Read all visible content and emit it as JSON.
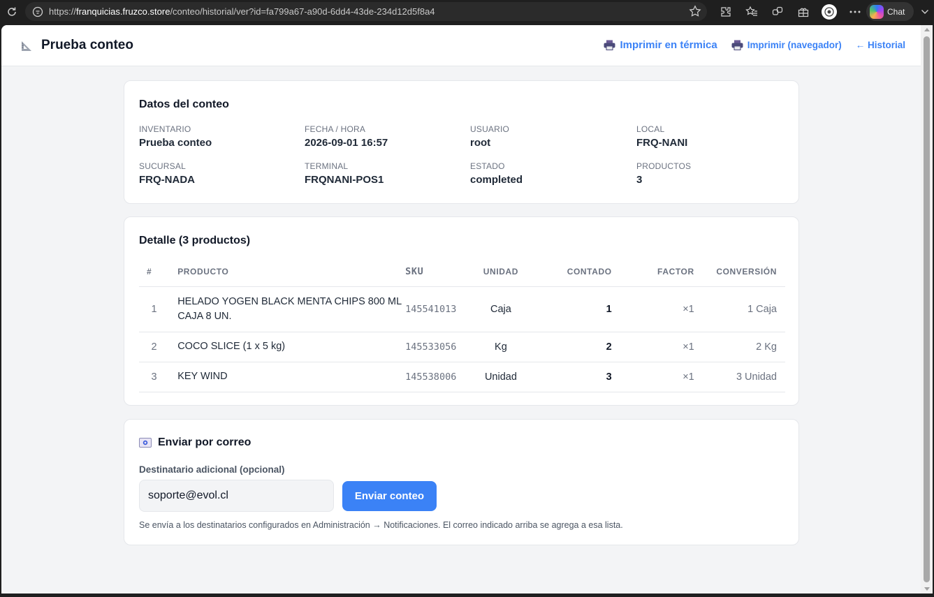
{
  "browser": {
    "url_scheme": "https://",
    "url_host": "franquicias.fruzco.store",
    "url_path": "/conteo/historial/ver?id=fa799a67-a90d-6dd4-43de-234d12d5f8a4",
    "chat_label": "Chat",
    "icons": [
      "reload-icon",
      "site-info-icon",
      "favorite-star-icon",
      "extensions-icon",
      "favorites-icon",
      "collections-icon",
      "browser-essentials-icon",
      "profile-icon",
      "more-icon",
      "copilot-icon",
      "chevron-icon"
    ]
  },
  "header": {
    "title": "Prueba conteo",
    "title_icon": "ruler-icon",
    "actions": {
      "print_thermal": "Imprimir en térmica",
      "print_browser": "Imprimir (navegador)",
      "history": "← Historial"
    }
  },
  "datos": {
    "title": "Datos del conteo",
    "fields": [
      {
        "label": "INVENTARIO",
        "value": "Prueba conteo"
      },
      {
        "label": "FECHA / HORA",
        "value": "2026-09-01 16:57"
      },
      {
        "label": "USUARIO",
        "value": "root"
      },
      {
        "label": "LOCAL",
        "value": "FRQ-NANI"
      },
      {
        "label": "SUCURSAL",
        "value": "FRQ-NADA"
      },
      {
        "label": "TERMINAL",
        "value": "FRQNANI-POS1"
      },
      {
        "label": "ESTADO",
        "value": "completed"
      },
      {
        "label": "PRODUCTOS",
        "value": "3"
      }
    ]
  },
  "detalle": {
    "title": "Detalle (3 productos)",
    "columns": {
      "num": "#",
      "producto": "PRODUCTO",
      "sku": "SKU",
      "unidad": "UNIDAD",
      "contado": "CONTADO",
      "factor": "FACTOR",
      "conversion": "CONVERSIÓN"
    },
    "rows": [
      {
        "num": "1",
        "producto": "HELADO YOGEN BLACK MENTA CHIPS 800 ML CAJA 8 UN.",
        "sku": "145541013",
        "unidad": "Caja",
        "contado": "1",
        "factor": "×1",
        "conversion": "1 Caja"
      },
      {
        "num": "2",
        "producto": "COCO SLICE (1 x 5 kg)",
        "sku": "145533056",
        "unidad": "Kg",
        "contado": "2",
        "factor": "×1",
        "conversion": "2 Kg"
      },
      {
        "num": "3",
        "producto": "KEY WIND",
        "sku": "145538006",
        "unidad": "Unidad",
        "contado": "3",
        "factor": "×1",
        "conversion": "3 Unidad"
      }
    ]
  },
  "correo": {
    "title": "Enviar por correo",
    "title_icon": "envelope-icon",
    "field_label": "Destinatario adicional (opcional)",
    "email_value": "soporte@evol.cl",
    "send_label": "Enviar conteo",
    "help": "Se envía a los destinatarios configurados en Administración → Notificaciones. El correo indicado arriba se agrega a esa lista."
  },
  "colors": {
    "accent": "#3b82f6",
    "page_bg": "#f3f4f6",
    "card_bg": "#ffffff",
    "text": "#111827",
    "muted": "#6b7280"
  }
}
